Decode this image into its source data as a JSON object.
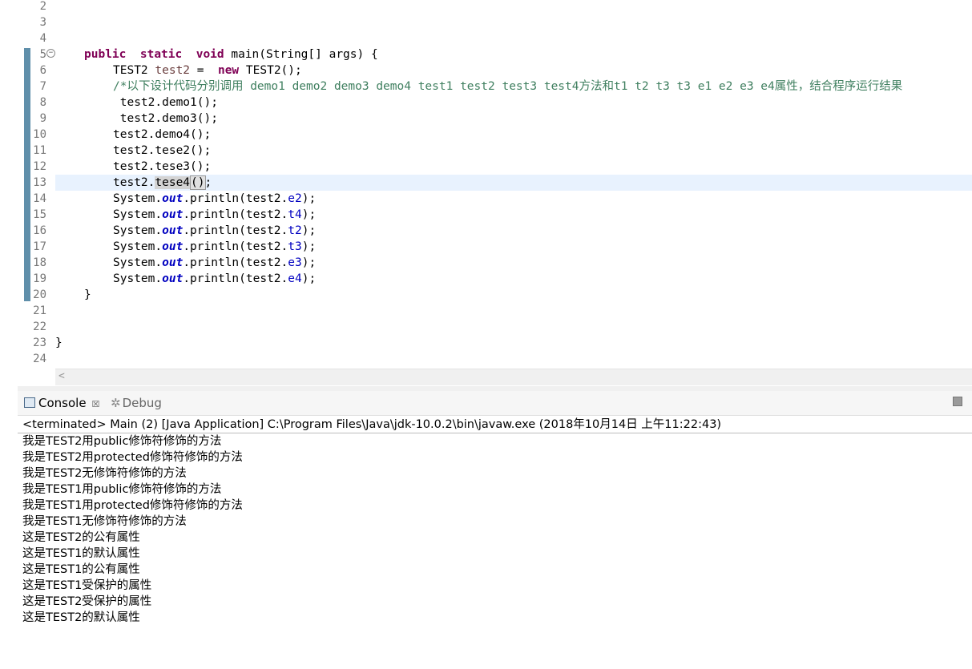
{
  "editor": {
    "line_numbers": [
      "2",
      "3",
      "4",
      "5",
      "6",
      "7",
      "8",
      "9",
      "10",
      "11",
      "12",
      "13",
      "14",
      "15",
      "16",
      "17",
      "18",
      "19",
      "20",
      "21",
      "22",
      "23",
      "24"
    ],
    "tokens": {
      "public": "public",
      "static": "static",
      "void": "void",
      "main_sig": " main(String[] args) {",
      "test2_decl_type": "TEST2 ",
      "test2_decl_var": "test2",
      "eq": " =  ",
      "new": "new",
      "ctor": " TEST2();",
      "comment": "/*以下设计代码分别调用 demo1 demo2 demo3 demo4 test1 test2 test3 test4方法和t1 t2 t3 t3 e1 e2 e3 e4属性，结合程序运行结果",
      "l8": " test2.demo1();",
      "l9": " test2.demo3();",
      "l10": "test2.demo4();",
      "l11": "test2.tese2();",
      "l12": "test2.tese3();",
      "l13_pre": "test2.",
      "l13_occ": "tese4",
      "l13_paren": "()",
      "l13_post": ";",
      "sys": "System.",
      "out": "out",
      "println_open": ".println(test2.",
      "close": ");",
      "fields": [
        "e2",
        "t4",
        "t2",
        "t3",
        "e3",
        "e4"
      ],
      "close_brace_method": "}",
      "close_brace_class": "}"
    }
  },
  "console": {
    "tab_console": "Console",
    "tab_console_close": "☒",
    "tab_debug": "Debug",
    "status": "<terminated> Main (2) [Java Application] C:\\Program Files\\Java\\jdk-10.0.2\\bin\\javaw.exe (2018年10月14日 上午11:22:43)",
    "output": [
      "我是TEST2用public修饰符修饰的方法",
      "我是TEST2用protected修饰符修饰的方法",
      "我是TEST2无修饰符修饰的方法",
      "我是TEST1用public修饰符修饰的方法",
      "我是TEST1用protected修饰符修饰的方法",
      "我是TEST1无修饰符修饰的方法",
      "这是TEST2的公有属性",
      "这是TEST1的默认属性",
      "这是TEST1的公有属性",
      "这是TEST1受保护的属性",
      "这是TEST2受保护的属性",
      "这是TEST2的默认属性"
    ]
  }
}
